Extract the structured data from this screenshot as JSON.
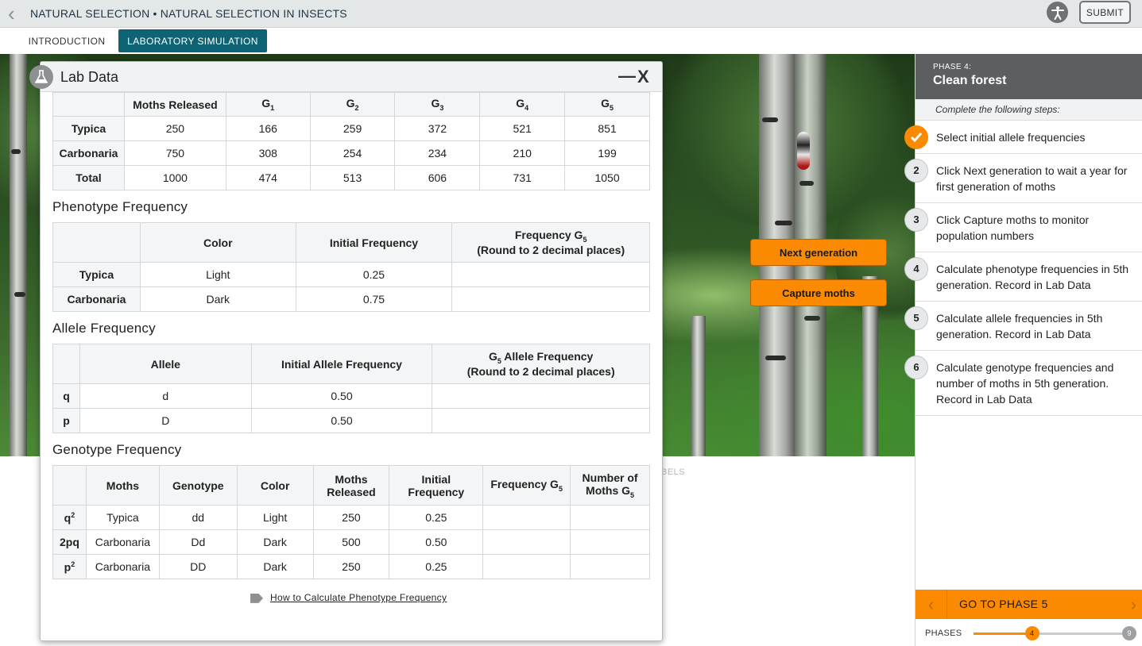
{
  "header": {
    "title": "NATURAL SELECTION • NATURAL SELECTION IN INSECTS",
    "submit": "SUBMIT"
  },
  "tabs": [
    {
      "label": "INTRODUCTION"
    },
    {
      "label": "LABORATORY SIMULATION"
    }
  ],
  "scene": {
    "next_generation": "Next generation",
    "capture_moths": "Capture moths",
    "labels_hint": "BELS"
  },
  "phase_panel": {
    "phase_number": "PHASE 4:",
    "phase_name": "Clean forest",
    "steps_intro": "Complete the following steps:",
    "steps": [
      {
        "num": "✓",
        "text": "Select initial allele frequencies"
      },
      {
        "num": "2",
        "text": "Click Next generation to wait a year for first generation of moths"
      },
      {
        "num": "3",
        "text": "Click Capture moths to monitor population numbers"
      },
      {
        "num": "4",
        "text": "Calculate phenotype frequencies in 5th generation. Record in Lab Data"
      },
      {
        "num": "5",
        "text": "Calculate allele frequencies in 5th generation. Record in Lab Data"
      },
      {
        "num": "6",
        "text": "Calculate genotype frequencies and number of moths in 5th generation. Record in Lab Data"
      }
    ],
    "goto": "GO TO PHASE 5",
    "phases_label": "PHASES",
    "phase_current": "4",
    "phase_max": "9",
    "progress_fraction": 0.375
  },
  "lab": {
    "title": "Lab Data",
    "population": {
      "headers": [
        "",
        "Moths Released",
        "G",
        "G",
        "G",
        "G",
        "G"
      ],
      "gen_subs": [
        "1",
        "2",
        "3",
        "4",
        "5"
      ],
      "rows": [
        [
          "Typica",
          "250",
          "166",
          "259",
          "372",
          "521",
          "851"
        ],
        [
          "Carbonaria",
          "750",
          "308",
          "254",
          "234",
          "210",
          "199"
        ],
        [
          "Total",
          "1000",
          "474",
          "513",
          "606",
          "731",
          "1050"
        ]
      ]
    },
    "phenotype": {
      "title": "Phenotype Frequency",
      "h_color": "Color",
      "h_initial": "Initial Frequency",
      "h_freq": "Frequency G",
      "h_freq_sub": "5",
      "h_round": "(Round to 2 decimal places)",
      "rows": [
        [
          "Typica",
          "Light",
          "0.25",
          ""
        ],
        [
          "Carbonaria",
          "Dark",
          "0.75",
          ""
        ]
      ]
    },
    "allele": {
      "title": "Allele Frequency",
      "h_allele": "Allele",
      "h_initial": "Initial Allele Frequency",
      "h_g": "G",
      "h_g_sub": "5",
      "h_freq": " Allele Frequency",
      "h_round": "(Round to 2 decimal places)",
      "rows": [
        [
          "q",
          "d",
          "0.50",
          ""
        ],
        [
          "p",
          "D",
          "0.50",
          ""
        ]
      ]
    },
    "genotype": {
      "title": "Genotype Frequency",
      "h_moths": "Moths",
      "h_genotype": "Genotype",
      "h_color": "Color",
      "h_released_1": "Moths",
      "h_released_2": "Released",
      "h_initial_1": "Initial",
      "h_initial_2": "Frequency",
      "h_freq": "Frequency G",
      "h_freq_sub": "5",
      "h_num_1": "Number of",
      "h_num_2": "Moths G",
      "h_num_sub": "5",
      "rows": [
        {
          "label": "q",
          "sup": "2",
          "moths": "Typica",
          "genotype": "dd",
          "color": "Light",
          "released": "250",
          "initial": "0.25"
        },
        {
          "label": "2pq",
          "sup": "",
          "moths": "Carbonaria",
          "genotype": "Dd",
          "color": "Dark",
          "released": "500",
          "initial": "0.50"
        },
        {
          "label": "p",
          "sup": "2",
          "moths": "Carbonaria",
          "genotype": "DD",
          "color": "Dark",
          "released": "250",
          "initial": "0.25"
        }
      ]
    },
    "help_link": "How to Calculate Phenotype Frequency"
  }
}
